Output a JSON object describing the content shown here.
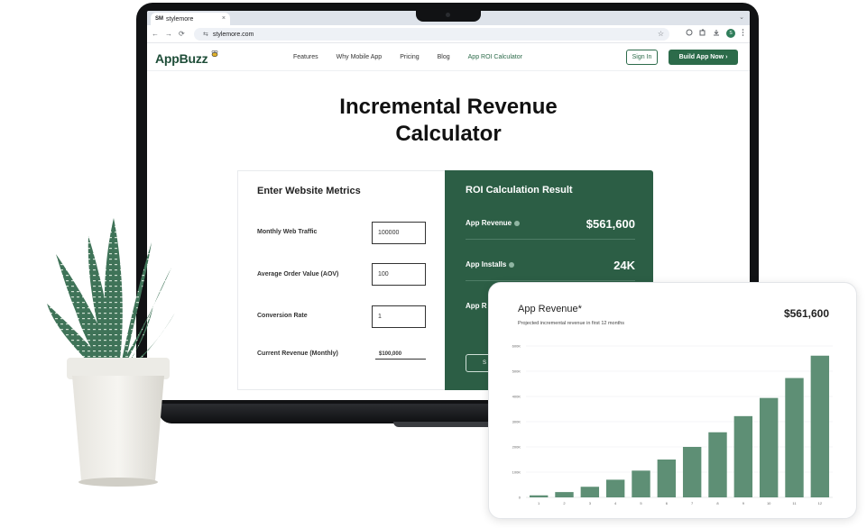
{
  "browser": {
    "tab_favicon": "SM",
    "tab_title": "stylemore",
    "tab_close": "×",
    "tab_menu": "⌄",
    "url": "stylemore.com",
    "nav_icons": [
      "←",
      "→",
      "⟳",
      "⇆"
    ],
    "star_icon": "☆",
    "profile_initial": "S"
  },
  "site": {
    "logo_text": "AppBuzz",
    "nav": [
      "Features",
      "Why Mobile App",
      "Pricing",
      "Blog",
      "App ROI Calculator"
    ],
    "signin_label": "Sign In",
    "build_label": "Build App Now",
    "build_chevron": "›"
  },
  "page": {
    "title_line1": "Incremental Revenue",
    "title_line2": "Calculator"
  },
  "calculator": {
    "heading": "Enter Website Metrics",
    "fields": [
      {
        "label": "Monthly Web Traffic",
        "value": "100000"
      },
      {
        "label": "Average Order Value (AOV)",
        "value": "100"
      },
      {
        "label": "Conversion Rate",
        "value": "1"
      }
    ],
    "current_revenue_label": "Current Revenue (Monthly)",
    "current_revenue_value": "$100,000"
  },
  "results": {
    "heading": "ROI Calculation Result",
    "rows": [
      {
        "label": "App Revenue",
        "value": "$561,600"
      },
      {
        "label": "App Installs",
        "value": "24K"
      },
      {
        "label": "App R",
        "value": ""
      }
    ],
    "button_fragment": "S"
  },
  "chart_card": {
    "title": "App Revenue*",
    "subtitle": "Projected incremental revenue in first 12 months",
    "total": "$561,600"
  },
  "colors": {
    "brand_green": "#2c5e45",
    "bar_green": "#5e8f75",
    "button_green": "#2c6b4a"
  },
  "chart_data": {
    "type": "bar",
    "title": "App Revenue*",
    "subtitle": "Projected incremental revenue in first 12 months",
    "categories": [
      "1",
      "2",
      "3",
      "4",
      "5",
      "6",
      "7",
      "8",
      "9",
      "10",
      "11",
      "12"
    ],
    "values": [
      8000,
      21000,
      42000,
      70000,
      106000,
      150000,
      200000,
      258000,
      322000,
      394000,
      473000,
      561600
    ],
    "yticks": [
      0,
      100000,
      200000,
      300000,
      400000,
      500000,
      600000
    ],
    "ytick_labels": [
      "0",
      "100K",
      "200K",
      "300K",
      "400K",
      "500K",
      "600K"
    ],
    "ylim": [
      0,
      600000
    ],
    "grid": true,
    "xlabel": "",
    "ylabel": ""
  }
}
